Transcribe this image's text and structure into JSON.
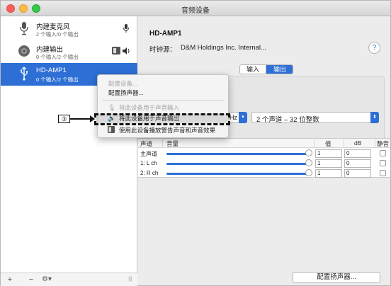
{
  "window": {
    "title": "音频设备"
  },
  "sidebar": {
    "devices": [
      {
        "name": "内建麦克风",
        "sub": "2 个输入/0 个输出",
        "icon": "microphone-icon",
        "right_icon": "microphone-small-icon"
      },
      {
        "name": "内建输出",
        "sub": "0 个输入/2 个输出",
        "icon": "speaker-icon",
        "right_icon": "finder-speaker-icons"
      },
      {
        "name": "HD-AMP1",
        "sub": "0 个输入/2 个输出",
        "icon": "usb-icon",
        "selected": true
      }
    ],
    "bottom": {
      "add": "+",
      "remove": "−",
      "gear": "⚙▾",
      "resize": "|||"
    }
  },
  "main": {
    "device_title": "HD-AMP1",
    "clock_label": "时钟源：",
    "clock_value": "D&M Holdings Inc. Internal...",
    "help": "?",
    "tabs": [
      "输入",
      "输出"
    ],
    "active_tab": "输出",
    "rate_value": "Hz",
    "format_value": "2 个声道 – 32 位整数",
    "table": {
      "headers": {
        "channel": "声道",
        "volume": "音量",
        "value": "值",
        "db": "dB",
        "mute": "静音"
      },
      "rows": [
        {
          "channel": "主声道",
          "value": "1",
          "db": "0"
        },
        {
          "channel": "1: L ch",
          "value": "1",
          "db": "0"
        },
        {
          "channel": "2: R ch",
          "value": "1",
          "db": "0"
        }
      ]
    },
    "configure_speakers_button": "配置扬声器..."
  },
  "context_menu": {
    "items": [
      {
        "label": "配置设备...",
        "disabled": true
      },
      {
        "label": "配置扬声器...",
        "disabled": false
      },
      {
        "label": "将此设备用于声音输入",
        "disabled": true,
        "icon": "microphone-icon"
      },
      {
        "label": "将此设备用于声音输出",
        "disabled": false,
        "icon": "speaker-icon",
        "highlighted": true
      },
      {
        "label": "使用此设备播放警告声音和声音效果",
        "disabled": false,
        "icon": "finder-icon"
      }
    ]
  },
  "callout": {
    "number": "③"
  },
  "colors": {
    "accent": "#2d6fd5",
    "selected_bg": "#2d6fd5"
  }
}
